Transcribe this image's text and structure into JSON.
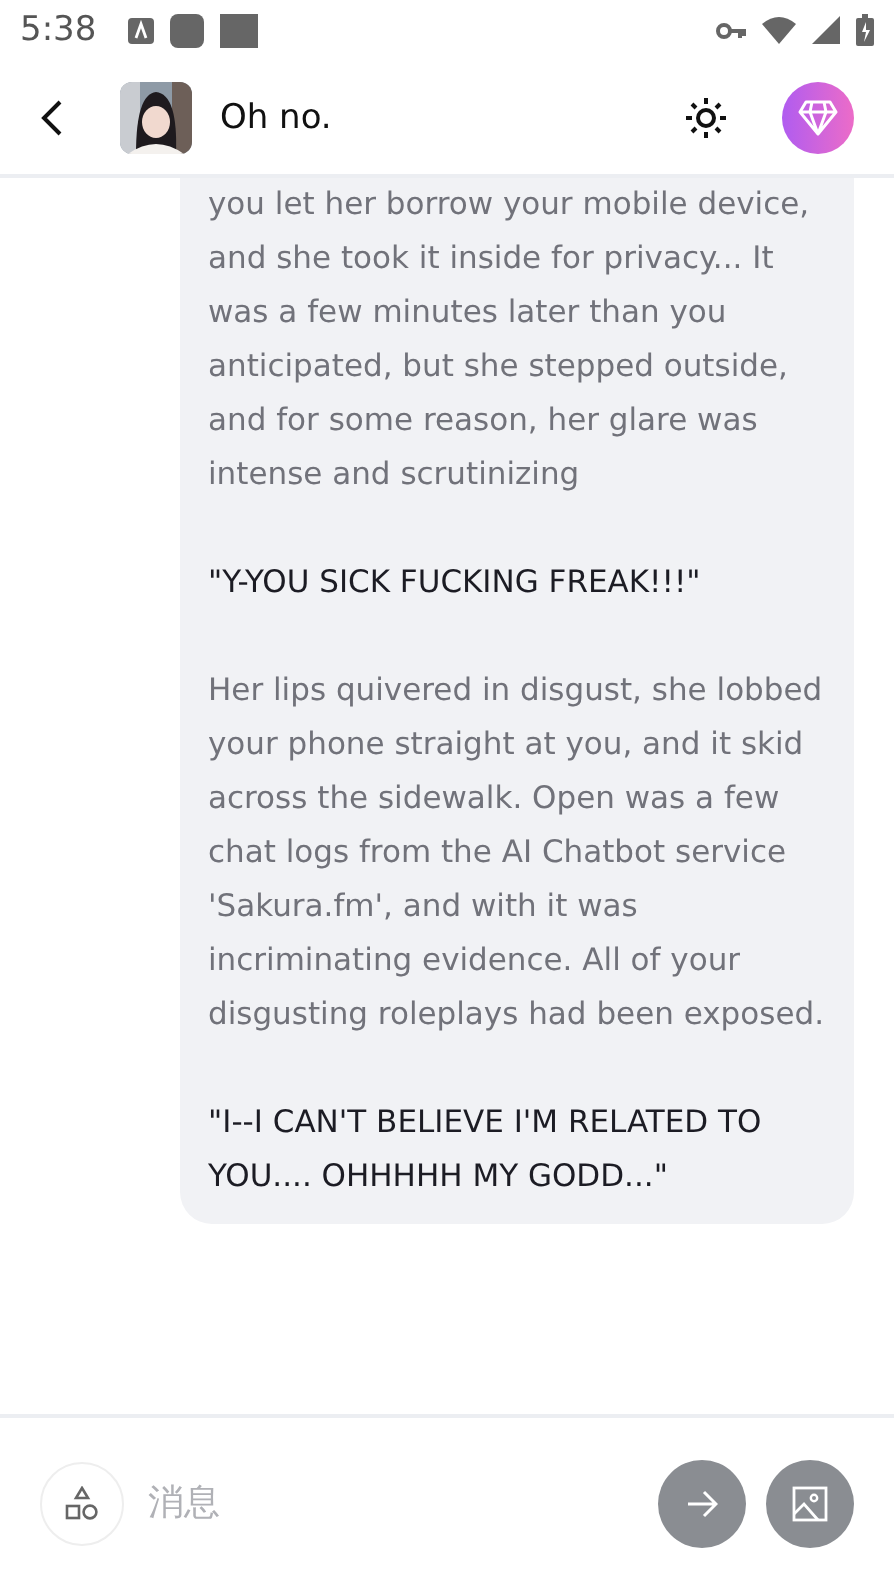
{
  "status_bar": {
    "time": "5:38"
  },
  "header": {
    "title": "Oh no."
  },
  "message": {
    "paragraphs": [
      {
        "kind": "narration",
        "text": "you let her borrow your mobile device, and she took it inside for privacy... It was a few minutes later than you anticipated, but she stepped outside, and for some reason, her glare was intense and scrutinizing"
      },
      {
        "kind": "speech",
        "text": "\"Y-YOU SICK FUCKING FREAK!!!\""
      },
      {
        "kind": "narration",
        "text": "Her lips quivered in disgust, she lobbed your phone straight at you, and it skid across the sidewalk. Open was a few chat logs from the AI Chatbot service 'Sakura.fm', and with it was incriminating evidence. All of your disgusting roleplays had been exposed."
      },
      {
        "kind": "speech",
        "text": "\"I--I CAN'T BELIEVE I'M RELATED TO YOU.... OHHHHH MY GODD...\""
      }
    ]
  },
  "composer": {
    "placeholder": "消息"
  }
}
